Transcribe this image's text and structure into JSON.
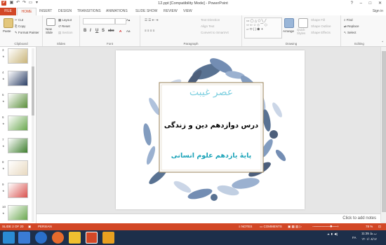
{
  "window": {
    "title": "12.ppt [Compatibility Mode] - PowerPoint",
    "controls": [
      "?",
      "–",
      "□",
      "✕"
    ]
  },
  "ribbon_tabs": {
    "file": "FILE",
    "home": "HOME",
    "items": [
      "INSERT",
      "DESIGN",
      "TRANSITIONS",
      "ANIMATIONS",
      "SLIDE SHOW",
      "REVIEW",
      "VIEW"
    ],
    "sign_in": "Sign in"
  },
  "ribbon": {
    "clipboard": {
      "paste": "Paste",
      "cut": "Cut",
      "copy": "Copy",
      "format_painter": "Format Painter",
      "label": "Clipboard"
    },
    "slides": {
      "new_slide": "New Slide",
      "layout": "Layout",
      "reset": "Reset",
      "section": "Section",
      "label": "Slides"
    },
    "font": {
      "bold": "B",
      "italic": "I",
      "underline": "U",
      "strike": "S",
      "shadow": "abc",
      "label": "Font"
    },
    "paragraph": {
      "text_direction": "Text Direction",
      "align_text": "Align Text",
      "convert": "Convert to SmartArt",
      "label": "Paragraph"
    },
    "drawing": {
      "arrange": "Arrange",
      "quick_styles": "Quick Styles",
      "shape_fill": "Shape Fill",
      "shape_outline": "Shape Outline",
      "shape_effects": "Shape Effects",
      "label": "Drawing"
    },
    "editing": {
      "find": "Find",
      "replace": "Replace",
      "select": "Select",
      "label": "Editing"
    }
  },
  "thumbnails": [
    {
      "num": "3",
      "color": "#c9b57a"
    },
    {
      "num": "4",
      "color": "#2c3f66"
    },
    {
      "num": "5",
      "color": "#5a8f3a"
    },
    {
      "num": "6",
      "color": "#6aa84f"
    },
    {
      "num": "7",
      "color": "#3f7f2f"
    },
    {
      "num": "8",
      "color": "#e8d9c0"
    },
    {
      "num": "9",
      "color": "#d9534f"
    },
    {
      "num": "10",
      "color": "#6aa84f"
    }
  ],
  "slide": {
    "title": "عصر غیبت",
    "subtitle": "درس دوازدهم دین و زندگی",
    "grade": "پایۀ یازدهم علوم انسانی",
    "title_color": "#7fd0e0",
    "grade_color": "#1aa3b8"
  },
  "notes": {
    "placeholder": "Click to add notes"
  },
  "status": {
    "slide_of": "SLIDE 2 OF 20",
    "language": "PERSIAN",
    "notes": "NOTES",
    "comments": "COMMENTS",
    "zoom": "78 %"
  },
  "taskbar": {
    "lang": "FA",
    "time": "11:35 ب.ظ",
    "date": "۱۴۰۱/۰۸/۱۷"
  },
  "colors": {
    "accent": "#d24726",
    "taskbar": "#1d2f4a"
  }
}
